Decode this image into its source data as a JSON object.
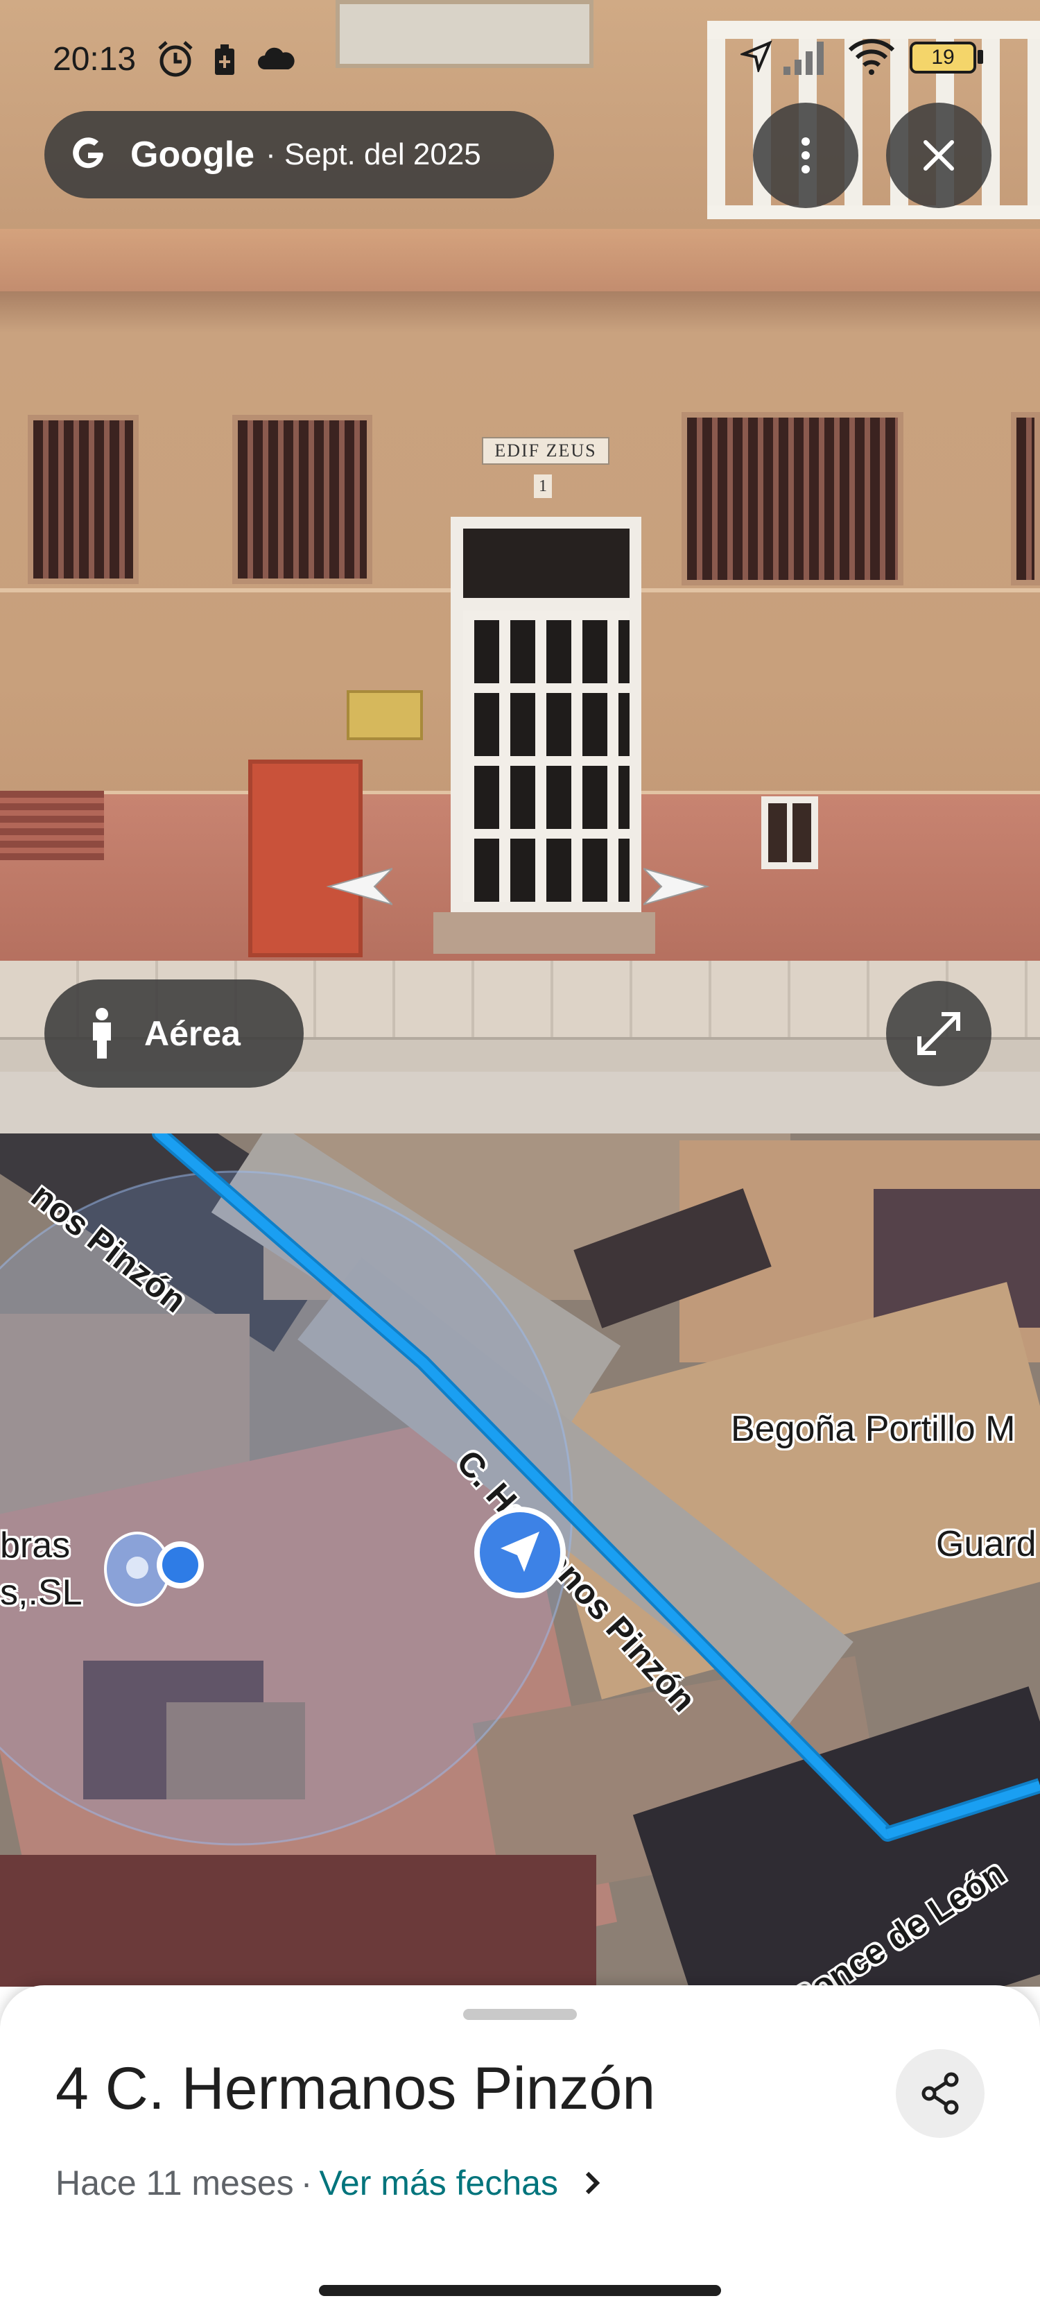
{
  "status_bar": {
    "time": "20:13",
    "battery": "19",
    "icons": [
      "alarm-icon",
      "battery-saver-icon",
      "cloud-icon",
      "location-arrow-icon",
      "signal-icon",
      "wifi-icon",
      "battery-icon"
    ]
  },
  "street_view": {
    "attribution": {
      "brand": "Google",
      "date": "· Sept. del 2025"
    },
    "building_plate": "EDIF ZEUS",
    "building_number": "1",
    "menu_icon": "more-vert-icon",
    "close_icon": "close-icon",
    "aerial_button": {
      "label": "Aérea",
      "icon": "pegman-icon"
    },
    "expand_icon": "fullscreen-icon",
    "nav_arrows": [
      "arrow-left-icon",
      "arrow-right-icon"
    ]
  },
  "map": {
    "streets": [
      {
        "label": "nos Pinzón"
      },
      {
        "label": "C. Hermanos Pinzón"
      },
      {
        "label": "Ponce de León"
      }
    ],
    "places": [
      {
        "label": "Begoña Portillo M"
      },
      {
        "label": "Guard"
      },
      {
        "label": "bras"
      },
      {
        "label": "s,.SL"
      }
    ],
    "colors": {
      "route": "#1a9ff2",
      "location": "#2e7ce6"
    }
  },
  "sheet": {
    "title": "4 C. Hermanos Pinzón",
    "age": "Hace 11 meses",
    "separator": "·",
    "more_dates": "Ver más fechas",
    "share_icon": "share-icon",
    "chevron_icon": "chevron-right-icon",
    "accent": "#00747c"
  }
}
